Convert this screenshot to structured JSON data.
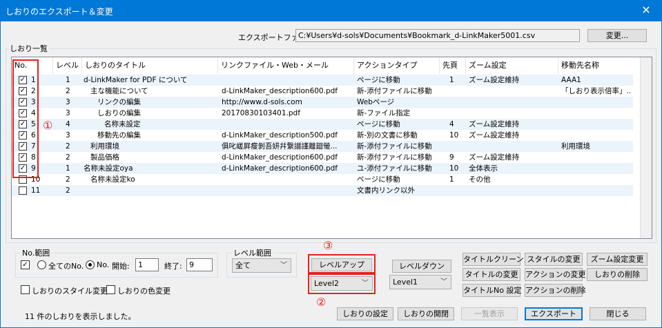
{
  "window": {
    "title": "しおりのエクスポート＆変更",
    "close_glyph": "✕"
  },
  "export_file": {
    "label": "エクスポートファイル:",
    "value": "C:¥Users¥d-sols¥Documents¥Bookmark_d-LinkMaker5001.csv",
    "change_button": "変更..."
  },
  "list_label": "しおり一覧",
  "table": {
    "columns": [
      "No.",
      "レベル",
      "しおりのタイトル",
      "リンクファイル・Web・メール",
      "アクションタイプ",
      "先頁",
      "ズーム設定",
      "移動先名称"
    ],
    "rows": [
      {
        "checked": true,
        "no": "1",
        "level": "1",
        "title": "d-LinkMaker for PDF について",
        "link": "",
        "action": "ページに移動",
        "page": "1",
        "zoom": "ズーム設定維持",
        "dest": "AAA1"
      },
      {
        "checked": true,
        "no": "2",
        "level": "2",
        "title": "主な機能について",
        "link": "d-LinkMaker_description600.pdf",
        "action": "新-添付ファイルに移動",
        "page": "",
        "zoom": "",
        "dest": "「しおり表示倍率」..."
      },
      {
        "checked": true,
        "no": "3",
        "level": "3",
        "title": "リンクの編集",
        "link": "http://www.d-sols.com",
        "action": "Webページ",
        "page": "",
        "zoom": "",
        "dest": ""
      },
      {
        "checked": true,
        "no": "4",
        "level": "3",
        "title": "しおりの編集",
        "link": "20170830103401.pdf",
        "action": "新-ファイル指定",
        "page": "",
        "zoom": "",
        "dest": ""
      },
      {
        "checked": true,
        "no": "5",
        "level": "4",
        "title": "名称未設定",
        "link": "",
        "action": "ページに移動",
        "page": "4",
        "zoom": "ズーム設定維持",
        "dest": ""
      },
      {
        "checked": true,
        "no": "6",
        "level": "3",
        "title": "移動先の編集",
        "link": "d-LinkMaker_description500.pdf",
        "action": "新-別の文書に移動",
        "page": "10",
        "zoom": "ズーム設定維持",
        "dest": ""
      },
      {
        "checked": true,
        "no": "7",
        "level": "2",
        "title": "利用環境",
        "link": "俱叱嵯屛瘦剝吾妍幷繋譛謹離廻螢...",
        "action": "新-添付ファイルに移動",
        "page": "",
        "zoom": "",
        "dest": "利用環境"
      },
      {
        "checked": true,
        "no": "8",
        "level": "2",
        "title": "製品価格",
        "link": "d-LinkMaker_description600.pdf",
        "action": "新-添付ファイルに移動",
        "page": "9",
        "zoom": "ズーム設定維持",
        "dest": ""
      },
      {
        "checked": true,
        "no": "9",
        "level": "1",
        "title": "名称未設定oya",
        "link": "d-LinkMaker_description600.pdf",
        "action": "ユ-添付ファイルに移動",
        "page": "10",
        "zoom": "全体表示",
        "dest": ""
      },
      {
        "checked": false,
        "no": "10",
        "level": "2",
        "title": "名称未設定ko",
        "link": "",
        "action": "ページに移動",
        "page": "1",
        "zoom": "その他",
        "dest": ""
      },
      {
        "checked": false,
        "no": "11",
        "level": "2",
        "title": "",
        "link": "",
        "action": "文書内リンク以外",
        "page": "",
        "zoom": "",
        "dest": ""
      }
    ]
  },
  "annotations": {
    "one": "①",
    "two": "②",
    "three": "③"
  },
  "no_range": {
    "label": "No.範囲",
    "all_label": "全てのNo.",
    "no_label": "No.",
    "start_label": "開始:",
    "start_value": "1",
    "end_label": "終了:",
    "end_value": "9"
  },
  "level_range": {
    "label": "レベル範囲",
    "value": "全て"
  },
  "options": {
    "style_change": "しおりのスタイル変更",
    "color_change": "しおりの色変更"
  },
  "level_up": {
    "button": "レベルアップ",
    "select": "Level2"
  },
  "level_down": {
    "button": "レベルダウン",
    "select": "Level1"
  },
  "actions": {
    "title_clean": "タイトルクリーン",
    "style_change": "スタイルの変更",
    "zoom_change": "ズーム設定変更",
    "title_change": "タイトルの変更",
    "action_change": "アクションの変更",
    "delete_bookmark": "しおりの削除",
    "title_no": "タイトルNo 設定",
    "action_delete": "アクションの削除"
  },
  "status": "11 件のしおりを表示しました。",
  "bottom": {
    "settings": "しおりの設定",
    "open_close": "しおりの開閉",
    "list_view": "一覧表示",
    "export": "エクスポート",
    "close": "閉じる"
  }
}
